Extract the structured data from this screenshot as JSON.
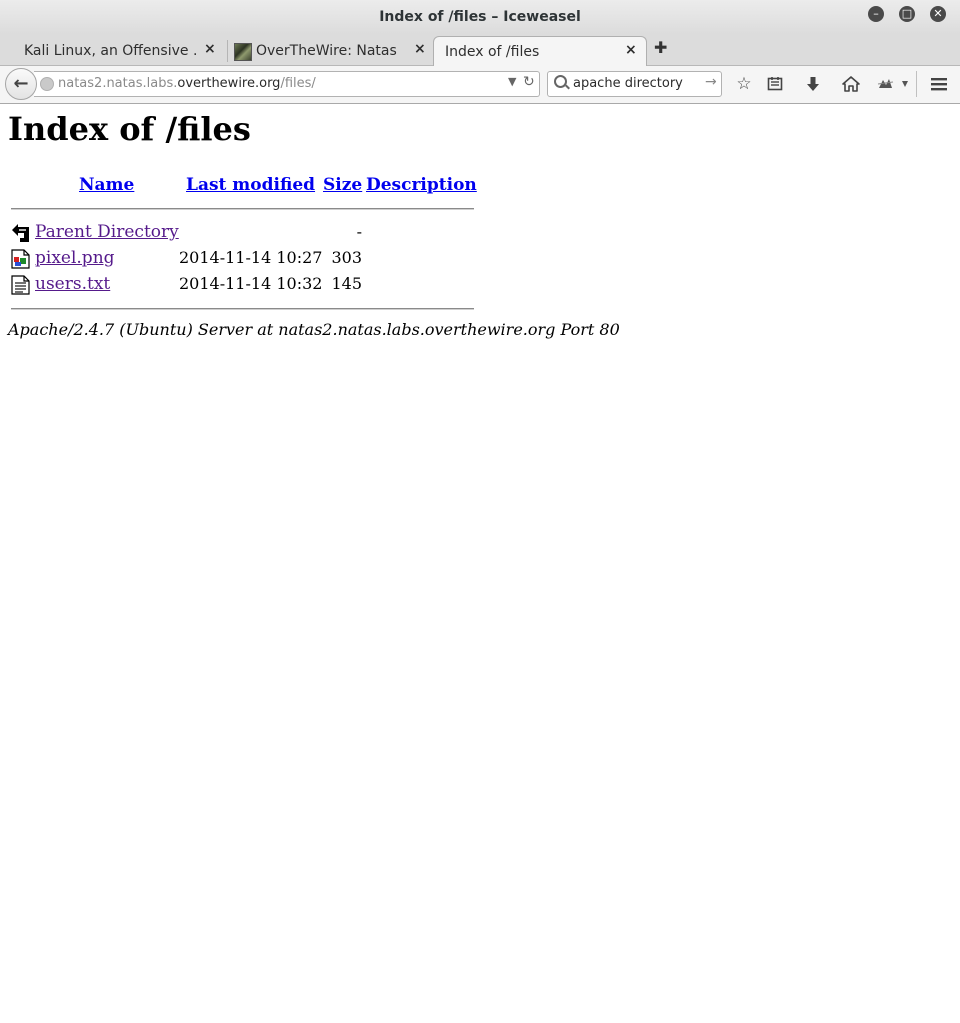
{
  "window": {
    "title": "Index of /files – Iceweasel"
  },
  "tabs": [
    {
      "label": "Kali Linux, an Offensive ...",
      "active": false
    },
    {
      "label": "OverTheWire: Natas",
      "active": false
    },
    {
      "label": "Index of /files",
      "active": true
    }
  ],
  "navbar": {
    "url_prefix": "natas2.natas.labs.",
    "url_domain": "overthewire.org",
    "url_path": "/files/",
    "search_value": "apache directory"
  },
  "page": {
    "heading": "Index of /files",
    "columns": {
      "name": "Name",
      "last_modified": "Last modified",
      "size": "Size",
      "description": "Description"
    },
    "rows": [
      {
        "name": "Parent Directory",
        "date": "",
        "size": "-",
        "icon": "back-icon"
      },
      {
        "name": "pixel.png",
        "date": "2014-11-14 10:27",
        "size": "303",
        "icon": "image-icon"
      },
      {
        "name": "users.txt",
        "date": "2014-11-14 10:32",
        "size": "145",
        "icon": "text-file-icon"
      }
    ],
    "footer": "Apache/2.4.7 (Ubuntu) Server at natas2.natas.labs.overthewire.org Port 80"
  },
  "colors": {
    "link": "#0000ee",
    "visited_link": "#551a8b"
  }
}
